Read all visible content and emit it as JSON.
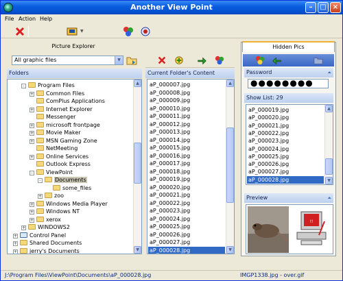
{
  "window": {
    "title": "Another View Point"
  },
  "menu": [
    "File",
    "Action",
    "Help"
  ],
  "left_panel": {
    "header": "Picture Explorer",
    "filter": "All graphic files",
    "folders_label": "Folders",
    "tree": [
      {
        "label": "Program Files",
        "level": 1,
        "exp": "-"
      },
      {
        "label": "Common Files",
        "level": 2,
        "exp": "+"
      },
      {
        "label": "ComPlus Applications",
        "level": 2,
        "exp": ""
      },
      {
        "label": "Internet Explorer",
        "level": 2,
        "exp": "+"
      },
      {
        "label": "Messenger",
        "level": 2,
        "exp": ""
      },
      {
        "label": "microsoft frontpage",
        "level": 2,
        "exp": "+"
      },
      {
        "label": "Movie Maker",
        "level": 2,
        "exp": "+"
      },
      {
        "label": "MSN Gaming Zone",
        "level": 2,
        "exp": "+"
      },
      {
        "label": "NetMeeting",
        "level": 2,
        "exp": ""
      },
      {
        "label": "Online Services",
        "level": 2,
        "exp": "+"
      },
      {
        "label": "Outlook Express",
        "level": 2,
        "exp": ""
      },
      {
        "label": "ViewPoint",
        "level": 2,
        "exp": "-"
      },
      {
        "label": "Documents",
        "level": 3,
        "exp": "-",
        "selected": true
      },
      {
        "label": "some_files",
        "level": 4,
        "exp": ""
      },
      {
        "label": "zoo",
        "level": 3,
        "exp": "+"
      },
      {
        "label": "Windows Media Player",
        "level": 2,
        "exp": "+"
      },
      {
        "label": "Windows NT",
        "level": 2,
        "exp": "+"
      },
      {
        "label": "xerox",
        "level": 2,
        "exp": "+"
      },
      {
        "label": "WINDOWS2",
        "level": 1,
        "exp": "+"
      },
      {
        "label": "Control Panel",
        "level": 0,
        "exp": "+"
      },
      {
        "label": "Shared Documents",
        "level": 0,
        "exp": "+"
      },
      {
        "label": "jerry's Documents",
        "level": 0,
        "exp": "+"
      }
    ]
  },
  "middle_panel": {
    "header": "Current Folder's Content",
    "files": [
      "aP_000007.jpg",
      "aP_000008.jpg",
      "aP_000009.jpg",
      "aP_000010.jpg",
      "aP_000011.jpg",
      "aP_000012.jpg",
      "aP_000013.jpg",
      "aP_000014.jpg",
      "aP_000015.jpg",
      "aP_000016.jpg",
      "aP_000017.jpg",
      "aP_000018.jpg",
      "aP_000019.jpg",
      "aP_000020.jpg",
      "aP_000021.jpg",
      "aP_000022.jpg",
      "aP_000023.jpg",
      "aP_000024.jpg",
      "aP_000025.jpg",
      "aP_000026.jpg",
      "aP_000027.jpg",
      "aP_000028.jpg"
    ],
    "selected": "aP_000028.jpg"
  },
  "right_panel": {
    "header": "Hidden Pics",
    "password_label": "Password",
    "password_value": "●●●●●●●●",
    "show_list_label": "Show List: 29",
    "files": [
      "aP_000019.jpg",
      "aP_000020.jpg",
      "aP_000021.jpg",
      "aP_000022.jpg",
      "aP_000023.jpg",
      "aP_000024.jpg",
      "aP_000025.jpg",
      "aP_000026.jpg",
      "aP_000027.jpg",
      "aP_000028.jpg"
    ],
    "selected": "aP_000028.jpg",
    "preview_label": "Preview"
  },
  "status": {
    "left": "J:\\Program Files\\ViewPoint\\Documents\\aP_000028.jpg",
    "right": "IMGP1338.jpg - over.gif"
  },
  "colors": {
    "title_blue": "#0a5ee0",
    "selection": "#316ac5",
    "section_head": "#bcd0ef"
  },
  "icons": [
    "app-icon",
    "delete-icon",
    "hide-icon",
    "options-icon",
    "help-icon"
  ]
}
